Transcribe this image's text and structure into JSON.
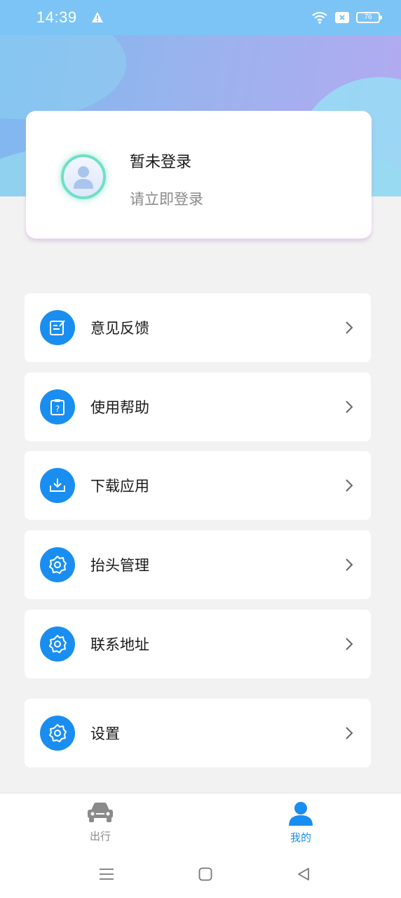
{
  "status_bar": {
    "time": "14:39",
    "battery": "76"
  },
  "profile": {
    "name": "暂未登录",
    "subtitle": "请立即登录"
  },
  "menu": [
    {
      "label": "意见反馈",
      "icon": "edit-note-icon"
    },
    {
      "label": "使用帮助",
      "icon": "help-clipboard-icon"
    },
    {
      "label": "下载应用",
      "icon": "download-tray-icon"
    },
    {
      "label": "抬头管理",
      "icon": "gear-icon"
    },
    {
      "label": "联系地址",
      "icon": "gear-icon"
    },
    {
      "label": "设置",
      "icon": "gear-icon"
    }
  ],
  "tab_bar": {
    "tabs": [
      {
        "label": "出行",
        "icon": "car-icon",
        "active": false
      },
      {
        "label": "我的",
        "icon": "user-icon",
        "active": true
      }
    ]
  },
  "colors": {
    "accent": "#1a8ef0",
    "status_bar": "#7cc4f5",
    "avatar_ring": "#6fe0c4",
    "inactive": "#8a8a8a"
  }
}
